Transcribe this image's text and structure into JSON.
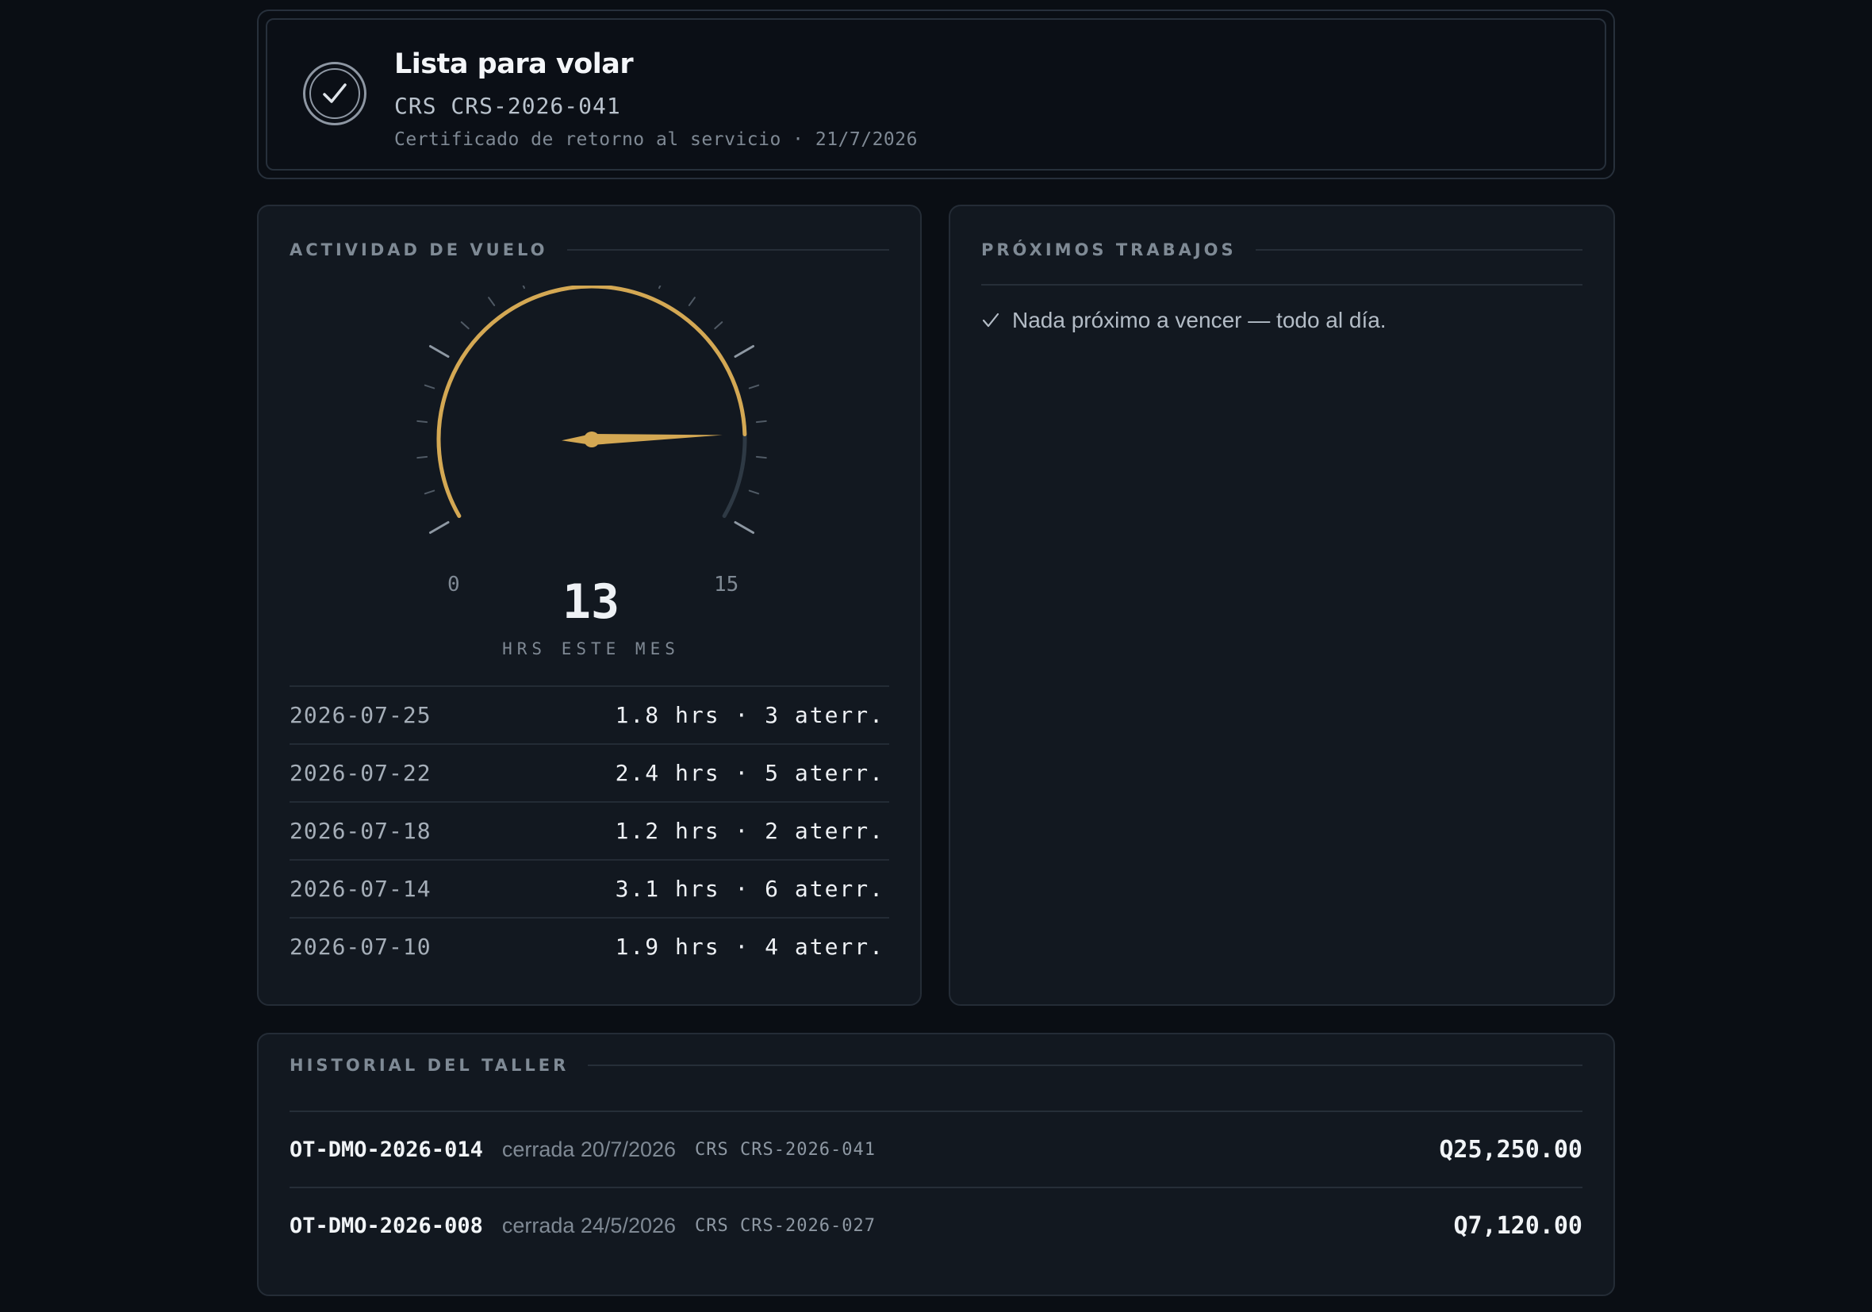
{
  "status": {
    "title": "Lista para volar",
    "crs": "CRS CRS-2026-041",
    "subtitle": "Certificado de retorno al servicio · 21/7/2026"
  },
  "flight_activity": {
    "heading": "ACTIVIDAD DE VUELO",
    "gauge": {
      "value": "13",
      "min": "0",
      "max": "15",
      "unit": "HRS ESTE MES",
      "fill_fraction": 0.867,
      "accent_color": "#d4a853"
    },
    "rows": [
      {
        "date": "2026-07-25",
        "value": "1.8 hrs · 3 aterr."
      },
      {
        "date": "2026-07-22",
        "value": "2.4 hrs · 5 aterr."
      },
      {
        "date": "2026-07-18",
        "value": "1.2 hrs · 2 aterr."
      },
      {
        "date": "2026-07-14",
        "value": "3.1 hrs · 6 aterr."
      },
      {
        "date": "2026-07-10",
        "value": "1.9 hrs · 4 aterr."
      }
    ]
  },
  "upcoming": {
    "heading": "PRÓXIMOS TRABAJOS",
    "empty_message": "Nada próximo a vencer — todo al día.",
    "icon": "check-icon"
  },
  "history": {
    "heading": "HISTORIAL DEL TALLER",
    "rows": [
      {
        "id": "OT-DMO-2026-014",
        "closed": "cerrada 20/7/2026",
        "crs": "CRS CRS-2026-041",
        "amount": "Q25,250.00"
      },
      {
        "id": "OT-DMO-2026-008",
        "closed": "cerrada 24/5/2026",
        "crs": "CRS CRS-2026-027",
        "amount": "Q7,120.00"
      }
    ]
  }
}
